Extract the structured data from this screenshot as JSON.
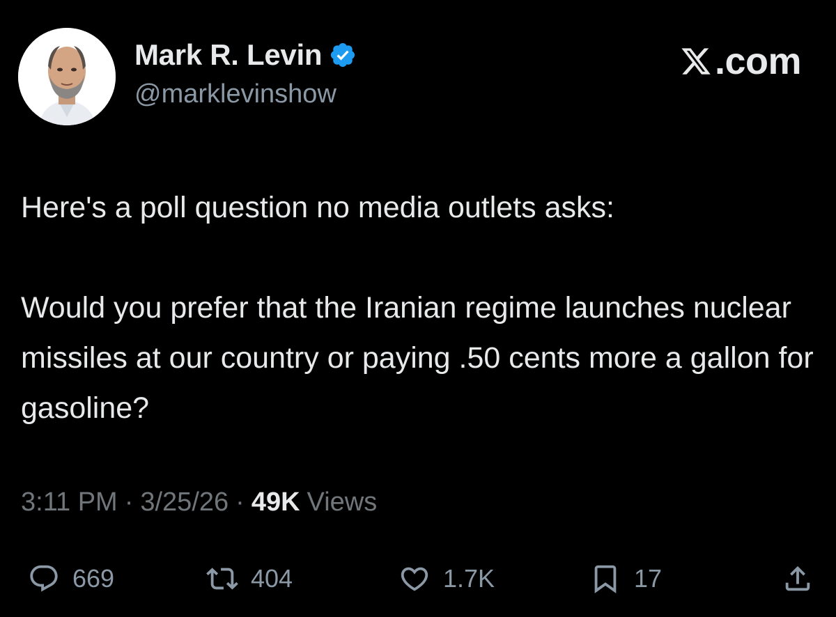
{
  "author": {
    "display_name": "Mark R. Levin",
    "handle": "@marklevinshow",
    "avatar_icon": "profile-photo",
    "verified_icon": "verified-badge-icon",
    "verified_color": "#1d9bf0"
  },
  "brand": {
    "icon": "x-logo-icon",
    "text": ".com"
  },
  "tweet": {
    "paragraphs": [
      "Here's a poll question no media outlets asks:",
      "Would you prefer that the Iranian regime launches nuclear missiles at our country or paying .50 cents more a gallon for gasoline?"
    ]
  },
  "meta": {
    "time": "3:11 PM",
    "separator": "·",
    "date": "3/25/26",
    "views_count": "49K",
    "views_label": "Views"
  },
  "actions": {
    "reply": {
      "icon": "reply-icon",
      "count": "669"
    },
    "retweet": {
      "icon": "retweet-icon",
      "count": "404"
    },
    "like": {
      "icon": "heart-icon",
      "count": "1.7K"
    },
    "bookmark": {
      "icon": "bookmark-icon",
      "count": "17"
    },
    "share": {
      "icon": "share-icon"
    }
  },
  "colors": {
    "background": "#000000",
    "primary_text": "#e7e9ea",
    "secondary_text": "#71767b",
    "icon_gray": "#8b98a5",
    "accent_blue": "#1d9bf0"
  }
}
